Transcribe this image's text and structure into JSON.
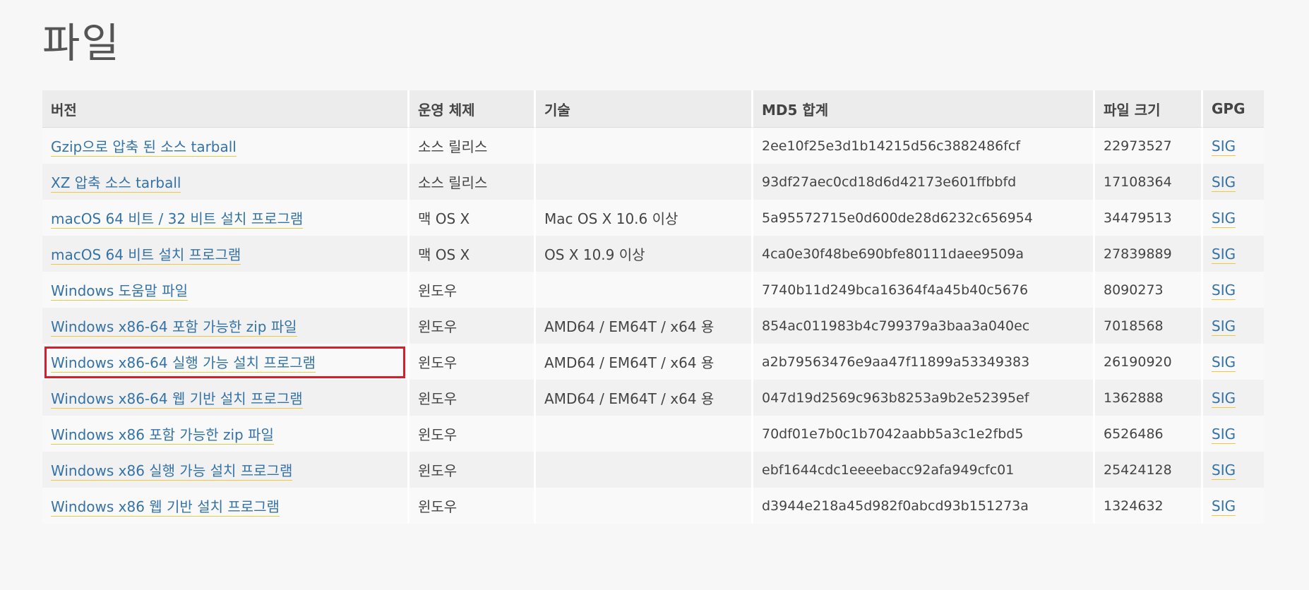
{
  "page": {
    "title": "파일"
  },
  "table": {
    "headers": {
      "version": "버전",
      "os": "운영 체제",
      "description": "기술",
      "md5": "MD5 합계",
      "size": "파일 크기",
      "gpg": "GPG"
    },
    "rows": [
      {
        "version": "Gzip으로 압축 된 소스 tarball",
        "os": "소스 릴리스",
        "description": "",
        "md5": "2ee10f25e3d1b14215d56c3882486fcf",
        "size": "22973527",
        "gpg": "SIG"
      },
      {
        "version": "XZ 압축 소스 tarball",
        "os": "소스 릴리스",
        "description": "",
        "md5": "93df27aec0cd18d6d42173e601ffbbfd",
        "size": "17108364",
        "gpg": "SIG"
      },
      {
        "version": "macOS 64 비트 / 32 비트 설치 프로그램",
        "os": "맥 OS X",
        "description": "Mac OS X 10.6 이상",
        "md5": "5a95572715e0d600de28d6232c656954",
        "size": "34479513",
        "gpg": "SIG"
      },
      {
        "version": "macOS 64 비트 설치 프로그램",
        "os": "맥 OS X",
        "description": "OS X 10.9 이상",
        "md5": "4ca0e30f48be690bfe80111daee9509a",
        "size": "27839889",
        "gpg": "SIG"
      },
      {
        "version": "Windows 도움말 파일",
        "os": "윈도우",
        "description": "",
        "md5": "7740b11d249bca16364f4a45b40c5676",
        "size": "8090273",
        "gpg": "SIG"
      },
      {
        "version": "Windows x86-64 포함 가능한 zip 파일",
        "os": "윈도우",
        "description": "AMD64 / EM64T / x64 용",
        "md5": "854ac011983b4c799379a3baa3a040ec",
        "size": "7018568",
        "gpg": "SIG"
      },
      {
        "version": "Windows x86-64 실행 가능 설치 프로그램",
        "os": "윈도우",
        "description": "AMD64 / EM64T / x64 용",
        "md5": "a2b79563476e9aa47f11899a53349383",
        "size": "26190920",
        "gpg": "SIG"
      },
      {
        "version": "Windows x86-64 웹 기반 설치 프로그램",
        "os": "윈도우",
        "description": "AMD64 / EM64T / x64 용",
        "md5": "047d19d2569c963b8253a9b2e52395ef",
        "size": "1362888",
        "gpg": "SIG"
      },
      {
        "version": "Windows x86 포함 가능한 zip 파일",
        "os": "윈도우",
        "description": "",
        "md5": "70df01e7b0c1b7042aabb5a3c1e2fbd5",
        "size": "6526486",
        "gpg": "SIG"
      },
      {
        "version": "Windows x86 실행 가능 설치 프로그램",
        "os": "윈도우",
        "description": "",
        "md5": "ebf1644cdc1eeeebacc92afa949cfc01",
        "size": "25424128",
        "gpg": "SIG"
      },
      {
        "version": "Windows x86 웹 기반 설치 프로그램",
        "os": "윈도우",
        "description": "",
        "md5": "d3944e218a45d982f0abcd93b151273a",
        "size": "1324632",
        "gpg": "SIG"
      }
    ]
  },
  "highlight": {
    "color": "#d81e2a",
    "row_index": 6
  },
  "colors": {
    "link": "#3572a5",
    "link_underline": "#f0c93a",
    "header_bg": "#ececec",
    "page_bg": "#f7f7f7"
  }
}
